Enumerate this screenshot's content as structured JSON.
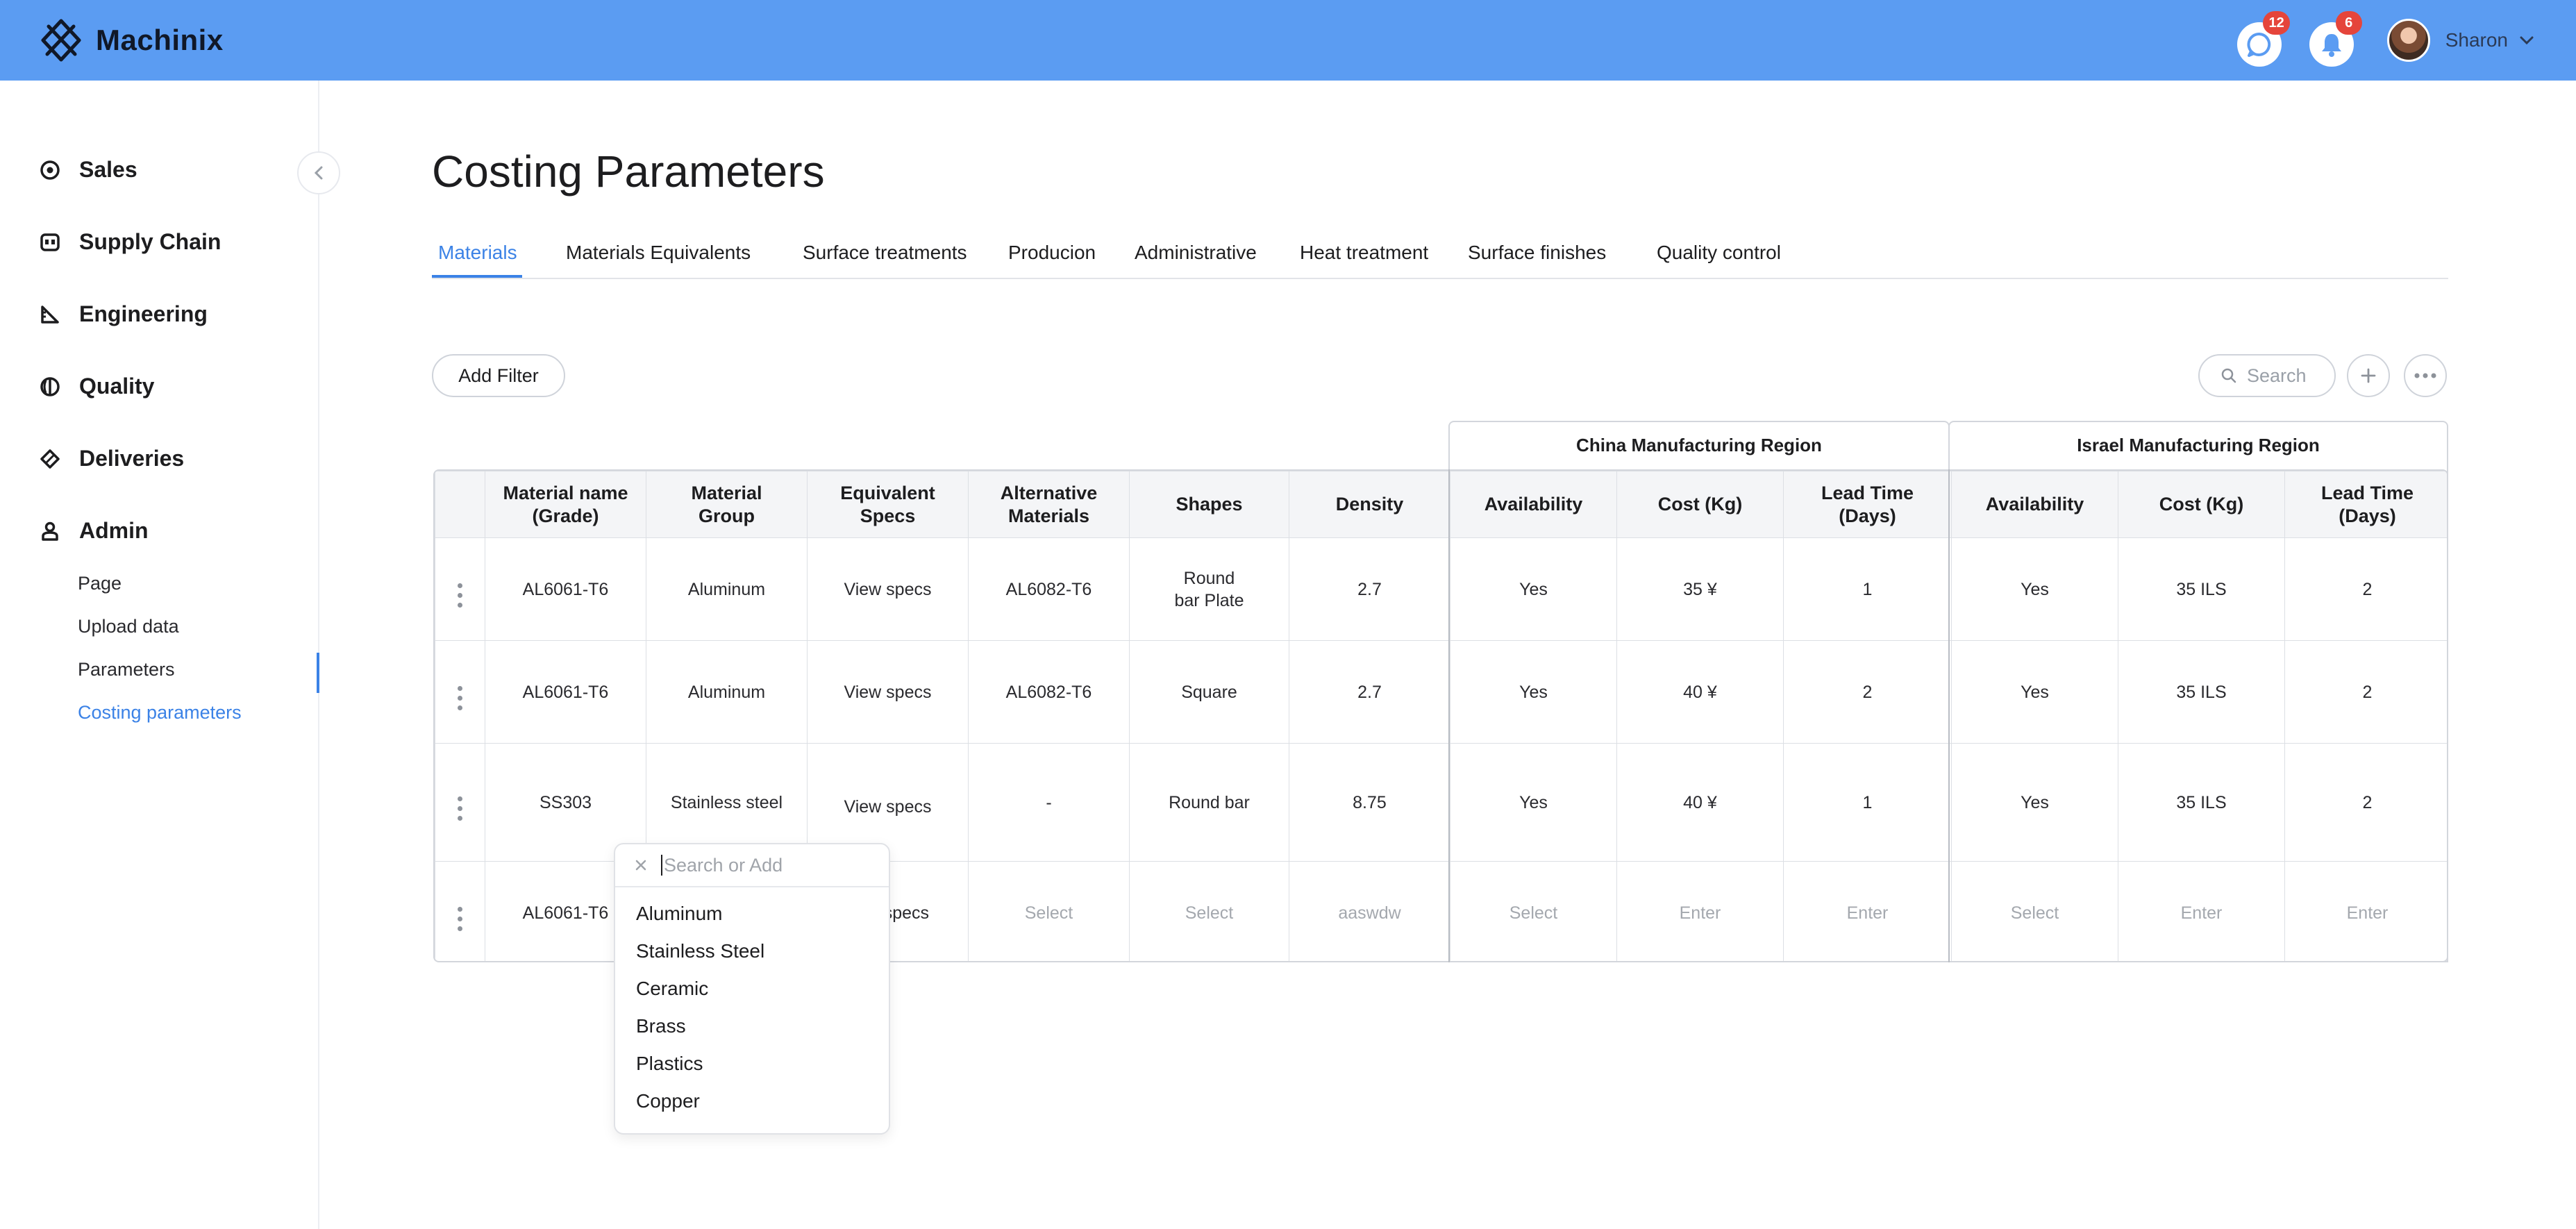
{
  "app": {
    "name": "Machinix"
  },
  "header": {
    "messages_badge": "12",
    "notifications_badge": "6",
    "user_name": "Sharon"
  },
  "sidebar": {
    "items": [
      {
        "label": "Sales",
        "icon": "target-icon"
      },
      {
        "label": "Supply Chain",
        "icon": "supply-chain-icon"
      },
      {
        "label": "Engineering",
        "icon": "ruler-triangle-icon"
      },
      {
        "label": "Quality",
        "icon": "quality-icon"
      },
      {
        "label": "Deliveries",
        "icon": "tag-icon"
      },
      {
        "label": "Admin",
        "icon": "user-icon"
      }
    ],
    "admin_sub": [
      "Page",
      "Upload data",
      "Parameters",
      "Costing parameters"
    ],
    "active_sub": "Costing parameters"
  },
  "page": {
    "title": "Costing Parameters",
    "tabs": [
      "Materials",
      "Materials Equivalents",
      "Surface treatments",
      "Producion",
      "Administrative",
      "Heat treatment",
      "Surface finishes",
      "Quality control"
    ],
    "active_tab": "Materials",
    "add_filter_label": "Add Filter",
    "search_placeholder": "Search"
  },
  "table": {
    "regions": [
      "China Manufacturing Region",
      "Israel Manufacturing Region"
    ],
    "columns": [
      "Material name (Grade)",
      "Material Group",
      "Equivalent Specs",
      "Alternative Materials",
      "Shapes",
      "Density",
      "Availability",
      "Cost (Kg)",
      "Lead Time (Days)",
      "Availability",
      "Cost (Kg)",
      "Lead Time (Days)"
    ],
    "rows": [
      [
        "AL6061-T6",
        "Aluminum",
        "View specs",
        "AL6082-T6",
        "Round bar Plate",
        "2.7",
        "Yes",
        "35 ¥",
        "1",
        "Yes",
        "35 ILS",
        "2"
      ],
      [
        "AL6061-T6",
        "Aluminum",
        "View specs",
        "AL6082-T6",
        "Square",
        "2.7",
        "Yes",
        "40 ¥",
        "2",
        "Yes",
        "35 ILS",
        "2"
      ],
      [
        "SS303",
        "Stainless steel",
        "View specs",
        "-",
        "Round bar",
        "8.75",
        "Yes",
        "40 ¥",
        "1",
        "Yes",
        "35 ILS",
        "2"
      ],
      [
        "AL6061-T6",
        "",
        "specs",
        "Select",
        "Select",
        "aaswdw",
        "Select",
        "Enter",
        "Enter",
        "Select",
        "Enter",
        "Enter"
      ]
    ]
  },
  "dropdown": {
    "placeholder": "Search or Add",
    "options": [
      "Aluminum",
      "Stainless Steel",
      "Ceramic",
      "Brass",
      "Plastics",
      "Copper"
    ]
  }
}
